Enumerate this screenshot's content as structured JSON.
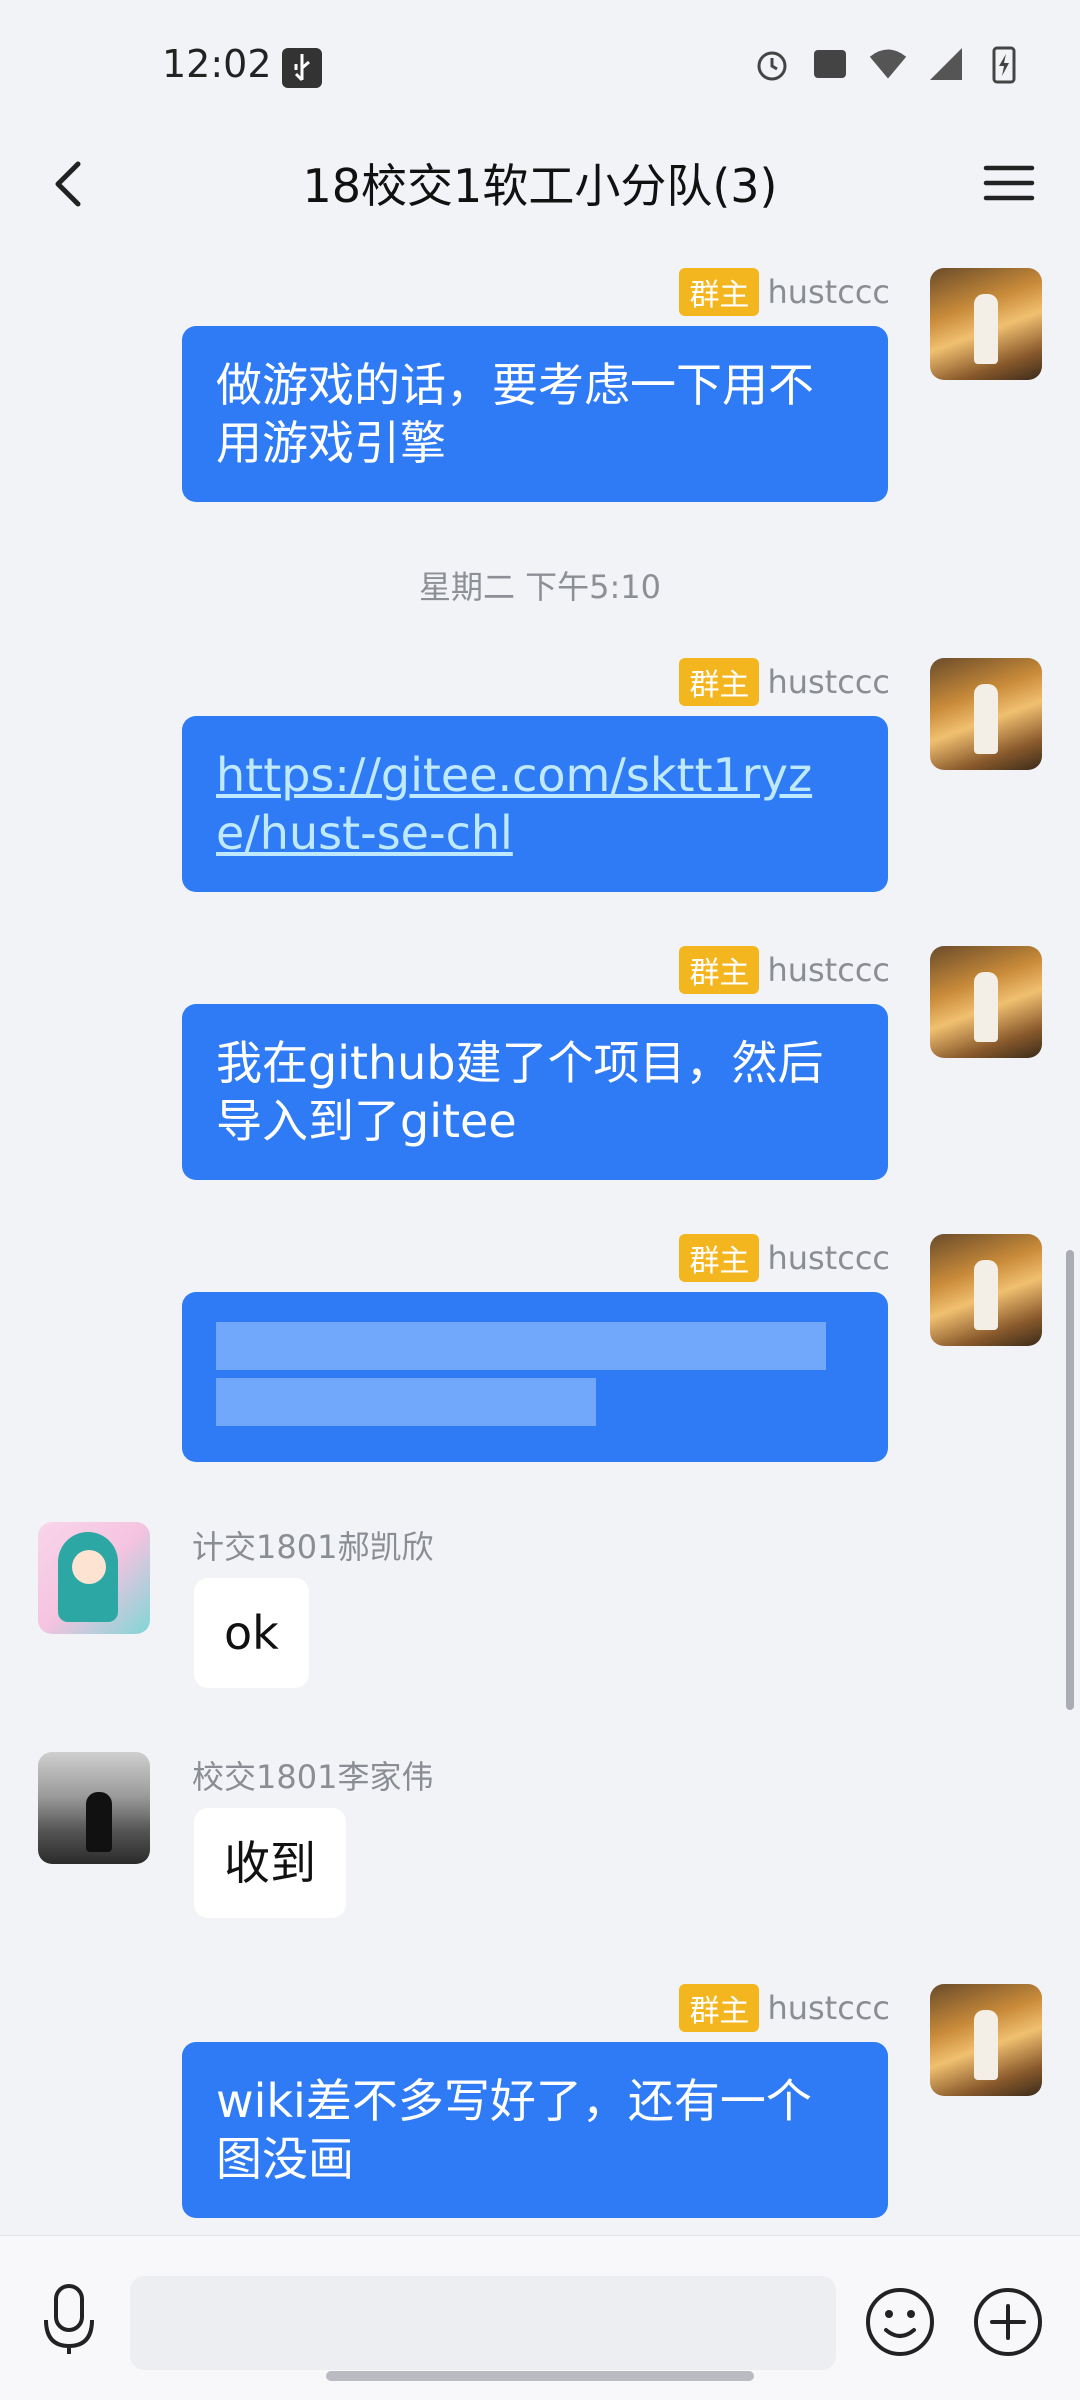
{
  "status_bar": {
    "time": "12:02"
  },
  "header": {
    "title": "18校交1软工小分队(3)"
  },
  "messages": [
    {
      "sender": "hustccc",
      "badge": "群主",
      "text": "做游戏的话，要考虑一下用不用游戏引擎"
    },
    {
      "time": "星期二 下午5:10"
    },
    {
      "sender": "hustccc",
      "badge": "群主",
      "link": "https://gitee.com/sktt1ryze/hust-se-chl"
    },
    {
      "sender": "hustccc",
      "badge": "群主",
      "text": "我在github建了个项目，然后导入到了gitee"
    },
    {
      "sender": "hustccc",
      "badge": "群主"
    },
    {
      "sender": "计交1801郝凯欣",
      "text": "ok"
    },
    {
      "sender": "校交1801李家伟",
      "text": "收到"
    },
    {
      "sender": "hustccc",
      "badge": "群主",
      "text": "wiki差不多写好了，还有一个图没画"
    }
  ],
  "icons": {
    "back": "back-arrow-icon",
    "menu": "menu-icon",
    "mic": "microphone-icon",
    "emoji": "emoji-icon",
    "plus": "plus-icon"
  }
}
